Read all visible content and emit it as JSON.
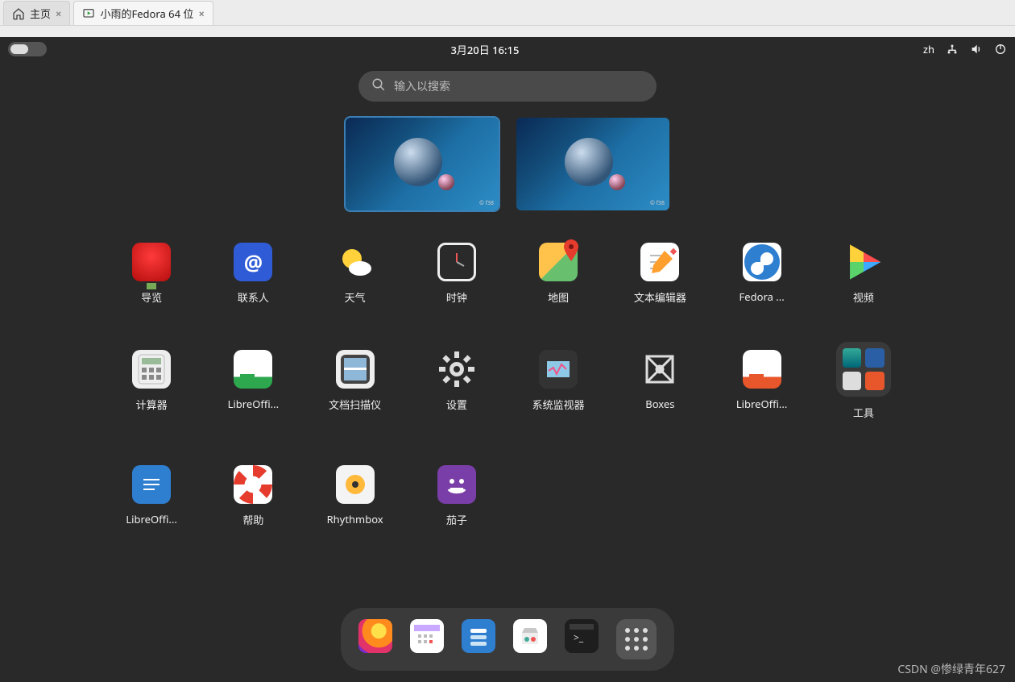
{
  "outer_tabs": {
    "home": "主页",
    "vm": "小雨的Fedora 64 位"
  },
  "topbar": {
    "clock": "3月20日  16:15",
    "ime": "zh"
  },
  "search": {
    "placeholder": "输入以搜索"
  },
  "apps": [
    {
      "id": "tour",
      "label": "导览"
    },
    {
      "id": "contacts",
      "label": "联系人"
    },
    {
      "id": "weather",
      "label": "天气"
    },
    {
      "id": "clock",
      "label": "时钟"
    },
    {
      "id": "maps",
      "label": "地图"
    },
    {
      "id": "text",
      "label": "文本编辑器"
    },
    {
      "id": "fedora",
      "label": "Fedora ..."
    },
    {
      "id": "video",
      "label": "视频"
    },
    {
      "id": "calc",
      "label": "计算器"
    },
    {
      "id": "lw",
      "label": "LibreOffi..."
    },
    {
      "id": "scan",
      "label": "文档扫描仪"
    },
    {
      "id": "settings",
      "label": "设置"
    },
    {
      "id": "sysmon",
      "label": "系统监视器"
    },
    {
      "id": "boxes",
      "label": "Boxes"
    },
    {
      "id": "li",
      "label": "LibreOffi..."
    },
    {
      "id": "tools",
      "label": "工具"
    },
    {
      "id": "lwriter",
      "label": "LibreOffi..."
    },
    {
      "id": "help",
      "label": "帮助"
    },
    {
      "id": "rhythm",
      "label": "Rhythmbox"
    },
    {
      "id": "eggplant",
      "label": "茄子"
    }
  ],
  "dock": [
    {
      "id": "firefox"
    },
    {
      "id": "calendar"
    },
    {
      "id": "files"
    },
    {
      "id": "software"
    },
    {
      "id": "terminal"
    },
    {
      "id": "appgrid"
    }
  ],
  "watermark": "CSDN @惨绿青年627"
}
